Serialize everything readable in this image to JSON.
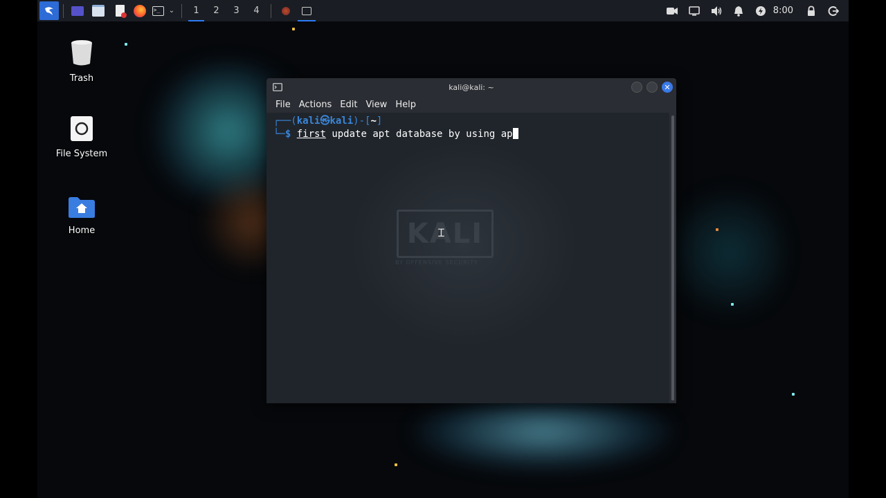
{
  "taskbar": {
    "workspaces": [
      "1",
      "2",
      "3",
      "4"
    ],
    "active_workspace": "1",
    "clock": "8:00"
  },
  "desktop": {
    "icons": [
      {
        "label": "Trash",
        "icon": "trash-icon"
      },
      {
        "label": "File System",
        "icon": "drive-icon"
      },
      {
        "label": "Home",
        "icon": "home-folder-icon"
      }
    ]
  },
  "terminal": {
    "title": "kali@kali: ~",
    "menu": [
      "File",
      "Actions",
      "Edit",
      "View",
      "Help"
    ],
    "prompt": {
      "frame_start": "┌──(",
      "user": "kali",
      "at": "㉿",
      "host": "kali",
      "frame_mid": ")-[",
      "dir": "~",
      "frame_end": "]",
      "corner": "└─",
      "symbol": "$"
    },
    "command_word": "first",
    "command_rest": " update apt database by using ap",
    "watermark": "KALI",
    "watermark_sub": "BY OFFENSIVE SECURITY"
  },
  "colors": {
    "accent": "#2e7cf6",
    "prompt_blue": "#3a86d9",
    "taskbar_bg": "#1a1d23",
    "terminal_bg": "#20252b"
  }
}
